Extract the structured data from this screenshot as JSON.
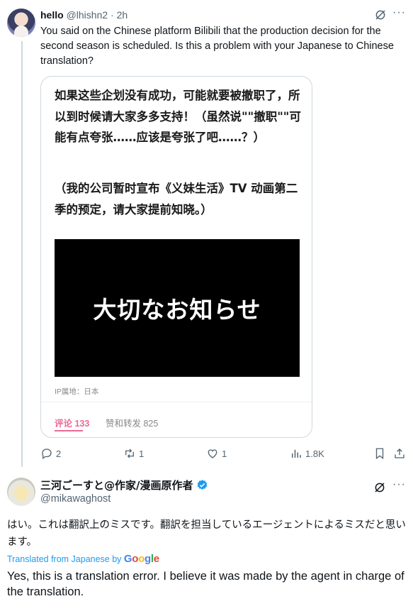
{
  "reply": {
    "name": "hello",
    "handle": "@lhishn2",
    "time": "· 2h",
    "text": "You said on the Chinese platform Bilibili that the production decision for the second season is scheduled. Is this a problem with your Japanese to Chinese translation?",
    "card": {
      "para1": "如果这些企划没有成功，可能就要被撤职了，所以到时候请大家多多支持！（虽然说\"\"撤职\"\"可能有点夸张……应该是夸张了吧……？）",
      "para2": "（我的公司暂时宣布《义妹生活》TV 动画第二季的预定，请大家提前知晓。）",
      "image_text": "大切なお知らせ",
      "ip": "IP属地：日本",
      "tab_comments": "评论 133",
      "tab_reposts": "赞和转发 825"
    },
    "actions": {
      "replies": "2",
      "retweets": "1",
      "likes": "1",
      "views": "1.8K"
    }
  },
  "main": {
    "name": "三河ごーすと@作家/漫画原作者",
    "handle": "@mikawaghost",
    "text_ja": "はい。これは翻訳上のミスです。翻訳を担当しているエージェントによるミスだと思います。",
    "translated_prefix": "Translated from Japanese by",
    "translator": "Google",
    "text_en": "Yes, this is a translation error. I believe it was made by the agent in charge of the translation."
  },
  "colors": {
    "link": "#1d9bf0",
    "muted": "#536471",
    "bili_pink": "#e86a92",
    "verified": "#1d9bf0"
  }
}
